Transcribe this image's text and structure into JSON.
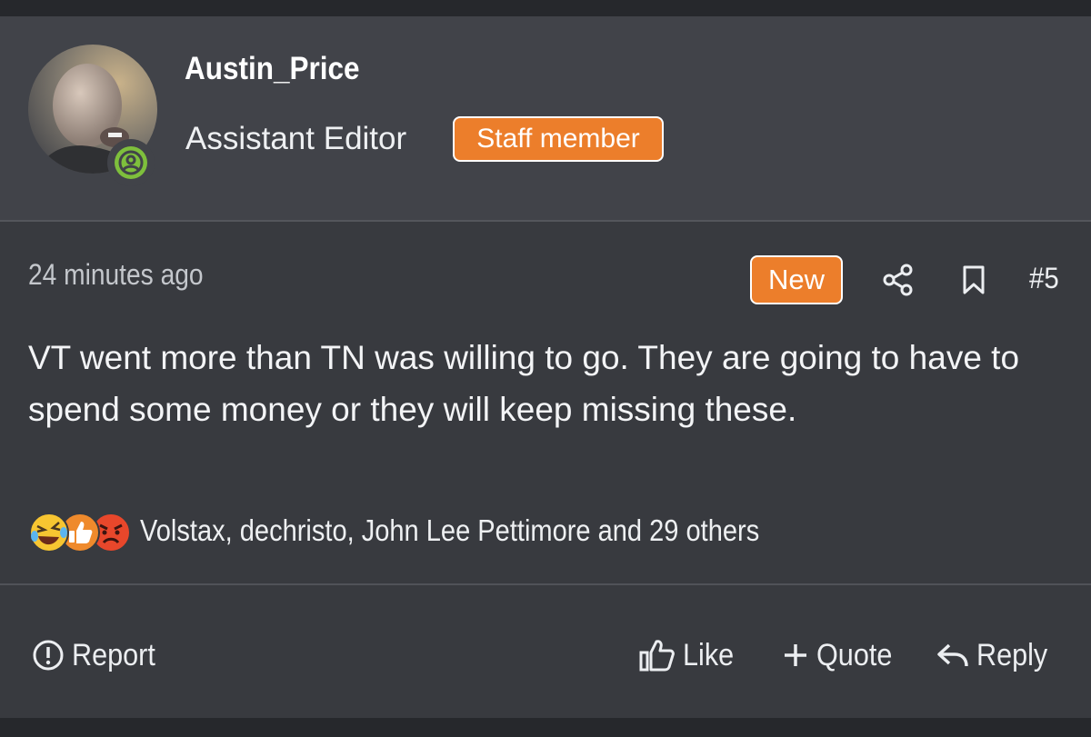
{
  "user": {
    "name": "Austin_Price",
    "title": "Assistant Editor",
    "badge": "Staff member"
  },
  "post": {
    "timestamp": "24 minutes ago",
    "new_badge": "New",
    "number": "#5",
    "message": "VT went more than TN was willing to go. They are going to have to spend some money or they will keep missing these."
  },
  "reactions": {
    "summary": "Volstax, dechristo, John Lee Pettimore and 29 others"
  },
  "actions": {
    "report": "Report",
    "like": "Like",
    "quote": "Quote",
    "reply": "Reply"
  },
  "colors": {
    "page_bg": "#26282c",
    "post_bg": "#383a3f",
    "header_bg": "#414349",
    "accent_orange": "#ec7e2b",
    "online_green": "#7ebf3c"
  },
  "icons": {
    "share": "share-icon",
    "bookmark": "bookmark-icon",
    "report": "alert-circle-icon",
    "like": "thumbs-up-icon",
    "quote": "plus-icon",
    "reply": "reply-arrow-icon"
  }
}
